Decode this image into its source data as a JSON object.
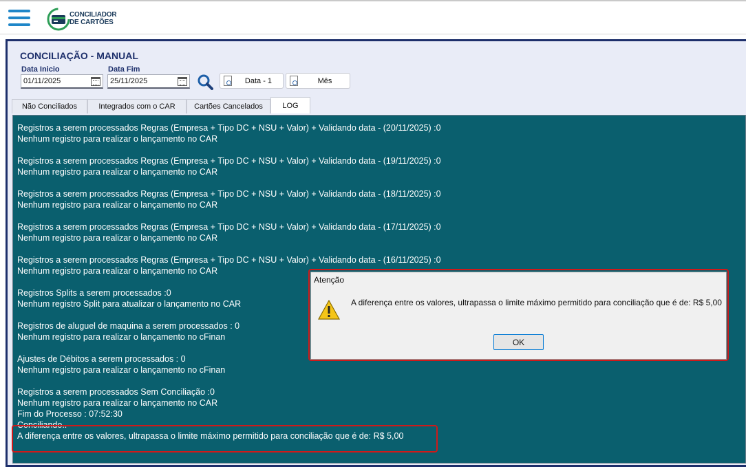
{
  "app": {
    "logo_line1": "CONCILIADOR",
    "logo_line2": "DE CARTÕES"
  },
  "header": {
    "title": "CONCILIAÇÃO - MANUAL",
    "start_label": "Data Inicio",
    "start_value": "01/11/2025",
    "end_label": "Data Fim",
    "end_value": "25/11/2025",
    "btn_data_minus": "Data - 1",
    "btn_month": "Mês"
  },
  "tabs": [
    {
      "label": "Não Conciliados"
    },
    {
      "label": "Integrados com o CAR"
    },
    {
      "label": "Cartões Cancelados"
    },
    {
      "label": "LOG",
      "active": true
    }
  ],
  "log_lines": [
    "Registros a serem processados Regras (Empresa + Tipo DC + NSU + Valor) + Validando data - (20/11/2025) :0",
    "Nenhum registro para realizar o lançamento no CAR",
    "",
    "Registros a serem processados Regras (Empresa + Tipo DC + NSU + Valor) + Validando data - (19/11/2025) :0",
    "Nenhum registro para realizar o lançamento no CAR",
    "",
    "Registros a serem processados Regras (Empresa + Tipo DC + NSU + Valor) + Validando data - (18/11/2025) :0",
    "Nenhum registro para realizar o lançamento no CAR",
    "",
    "Registros a serem processados Regras (Empresa + Tipo DC + NSU + Valor) + Validando data - (17/11/2025) :0",
    "Nenhum registro para realizar o lançamento no CAR",
    "",
    "Registros a serem processados Regras (Empresa + Tipo DC + NSU + Valor) + Validando data - (16/11/2025) :0",
    "Nenhum registro para realizar o lançamento no CAR",
    "",
    "Registros Splits a serem processados :0",
    "Nenhum registro Split para atualizar o lançamento no CAR",
    "",
    "Registros de aluguel de maquina a serem processados : 0",
    "Nenhum registro para realizar o lançamento no cFinan",
    "",
    "Ajustes de Débitos a serem processados : 0",
    "Nenhum registro para realizar o lançamento no cFinan",
    "",
    "Registros a serem processados Sem Conciliação :0",
    "Nenhum registro para realizar o lançamento no CAR",
    "Fim do Processo : 07:52:30",
    "Conciliando..",
    "A diferença entre os valores, ultrapassa o limite máximo permitido para conciliação que é de: R$ 5,00"
  ],
  "dialog": {
    "title": "Atenção",
    "message": "A diferença entre os valores, ultrapassa o limite máximo permitido para conciliação que é de: R$ 5,00",
    "ok_label": "OK"
  },
  "colors": {
    "log_bg": "#0a5f6e",
    "accent": "#1d2f6b",
    "highlight": "#d01919"
  }
}
